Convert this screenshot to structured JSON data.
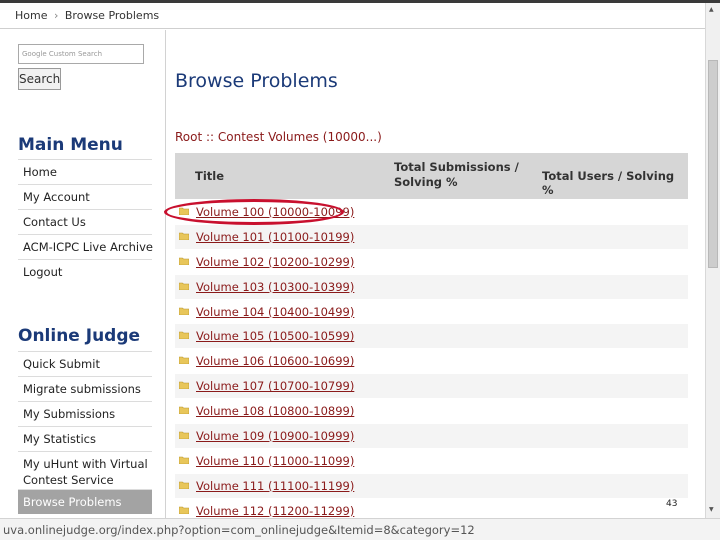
{
  "breadcrumb": {
    "home": "Home",
    "separator": "›",
    "current": "Browse Problems"
  },
  "search": {
    "placeholder": "Google Custom Search",
    "button_label": "Search"
  },
  "main_menu": {
    "title": "Main Menu",
    "items": [
      {
        "label": "Home"
      },
      {
        "label": "My Account"
      },
      {
        "label": "Contact Us"
      },
      {
        "label": "ACM-ICPC Live Archive"
      },
      {
        "label": "Logout"
      }
    ]
  },
  "online_judge": {
    "title": "Online Judge",
    "items": [
      {
        "label": "Quick Submit"
      },
      {
        "label": "Migrate submissions"
      },
      {
        "label": "My Submissions"
      },
      {
        "label": "My Statistics"
      },
      {
        "label": "My uHunt with Virtual Contest Service"
      },
      {
        "label": "Browse Problems",
        "active": true
      }
    ]
  },
  "main": {
    "title": "Browse Problems",
    "path": "Root :: Contest Volumes (10000...)"
  },
  "table": {
    "headers": {
      "title": "Title",
      "submissions": "Total Submissions / Solving %",
      "users": "Total Users / Solving %"
    },
    "rows": [
      {
        "label": "Volume 100 (10000-10099)"
      },
      {
        "label": "Volume 101 (10100-10199)"
      },
      {
        "label": "Volume 102 (10200-10299)"
      },
      {
        "label": "Volume 103 (10300-10399)"
      },
      {
        "label": "Volume 104 (10400-10499)"
      },
      {
        "label": "Volume 105 (10500-10599)"
      },
      {
        "label": "Volume 106 (10600-10699)"
      },
      {
        "label": "Volume 107 (10700-10799)"
      },
      {
        "label": "Volume 108 (10800-10899)"
      },
      {
        "label": "Volume 109 (10900-10999)"
      },
      {
        "label": "Volume 110 (11000-11099)"
      },
      {
        "label": "Volume 111 (11100-11199)"
      },
      {
        "label": "Volume 112 (11200-11299)"
      }
    ]
  },
  "slide_number": "43",
  "status_url": "uva.onlinejudge.org/index.php?option=com_onlinejudge&Itemid=8&category=12",
  "colors": {
    "link": "#8a1a1a",
    "heading": "#1b3a78",
    "highlight": "#c8102e",
    "folder": "#e8c65a"
  }
}
